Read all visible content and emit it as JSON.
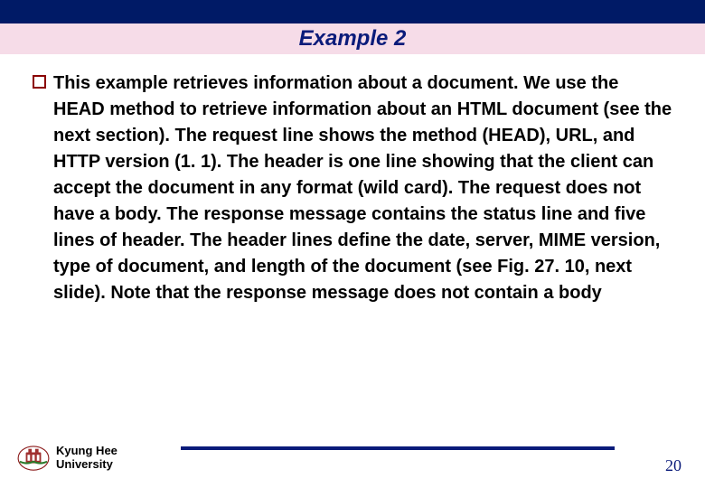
{
  "header": {
    "title": "Example 2"
  },
  "content": {
    "paragraph": "This example retrieves information about a document. We use the HEAD method to retrieve information about an HTML document (see the next section). The request line shows the method (HEAD), URL, and HTTP version (1. 1). The header is one line showing that the client can accept the document in any format (wild card). The request does not have a body. The response message contains the status line and five lines of header. The header lines define the date, server, MIME version, type of document, and length of the document (see Fig. 27. 10, next slide). Note that the response message does not contain a body"
  },
  "footer": {
    "university_line1": "Kyung Hee",
    "university_line2": "University",
    "page_number": "20"
  },
  "colors": {
    "accent": "#0a1b7a",
    "title_bg": "#f6dce8",
    "top_bar": "#001a66",
    "bullet_border": "#8b0000"
  }
}
